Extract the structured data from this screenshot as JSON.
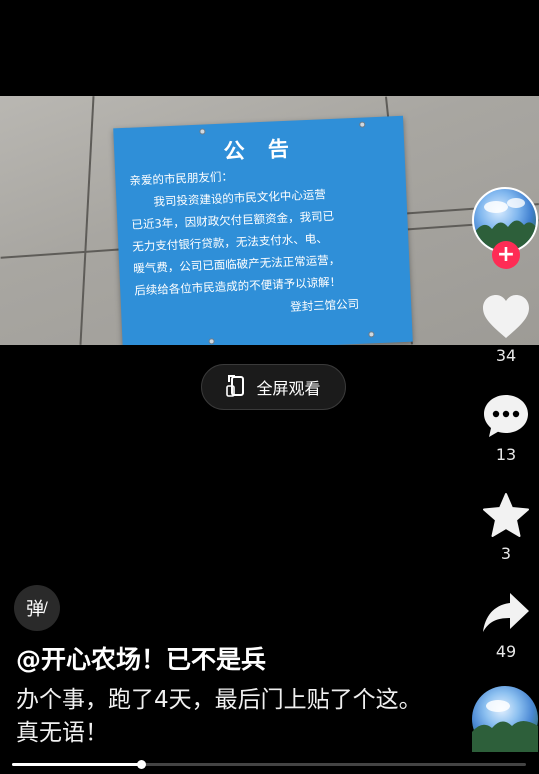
{
  "video": {
    "notice": {
      "title": "公 告",
      "lines": [
        "亲爱的市民朋友们：",
        "　　我司投资建设的市民文化中心运营",
        "已近3年，因财政欠付巨额资金，我司已",
        "无力支付银行贷款，无法支付水、电、",
        "暖气费，公司已面临破产无法正常运营，",
        "后续给各位市民造成的不便请予以谅解！"
      ],
      "signature": "登封三馆公司"
    },
    "fullscreen_label": "全屏观看",
    "fullscreen_icon": "fullscreen-rotate-icon"
  },
  "rail": {
    "avatar_icon": "author-avatar",
    "follow_icon": "plus-icon",
    "like_count": "34",
    "comment_count": "13",
    "favorite_count": "3",
    "share_count": "49",
    "colors": {
      "follow": "#fe2c55",
      "icon": "#f2f2f2"
    }
  },
  "danmu_label": "弹",
  "author": "@开心农场！已不是兵",
  "caption": "办个事，跑了4天，最后门上贴了个这。真无语！",
  "progress": 0.25
}
